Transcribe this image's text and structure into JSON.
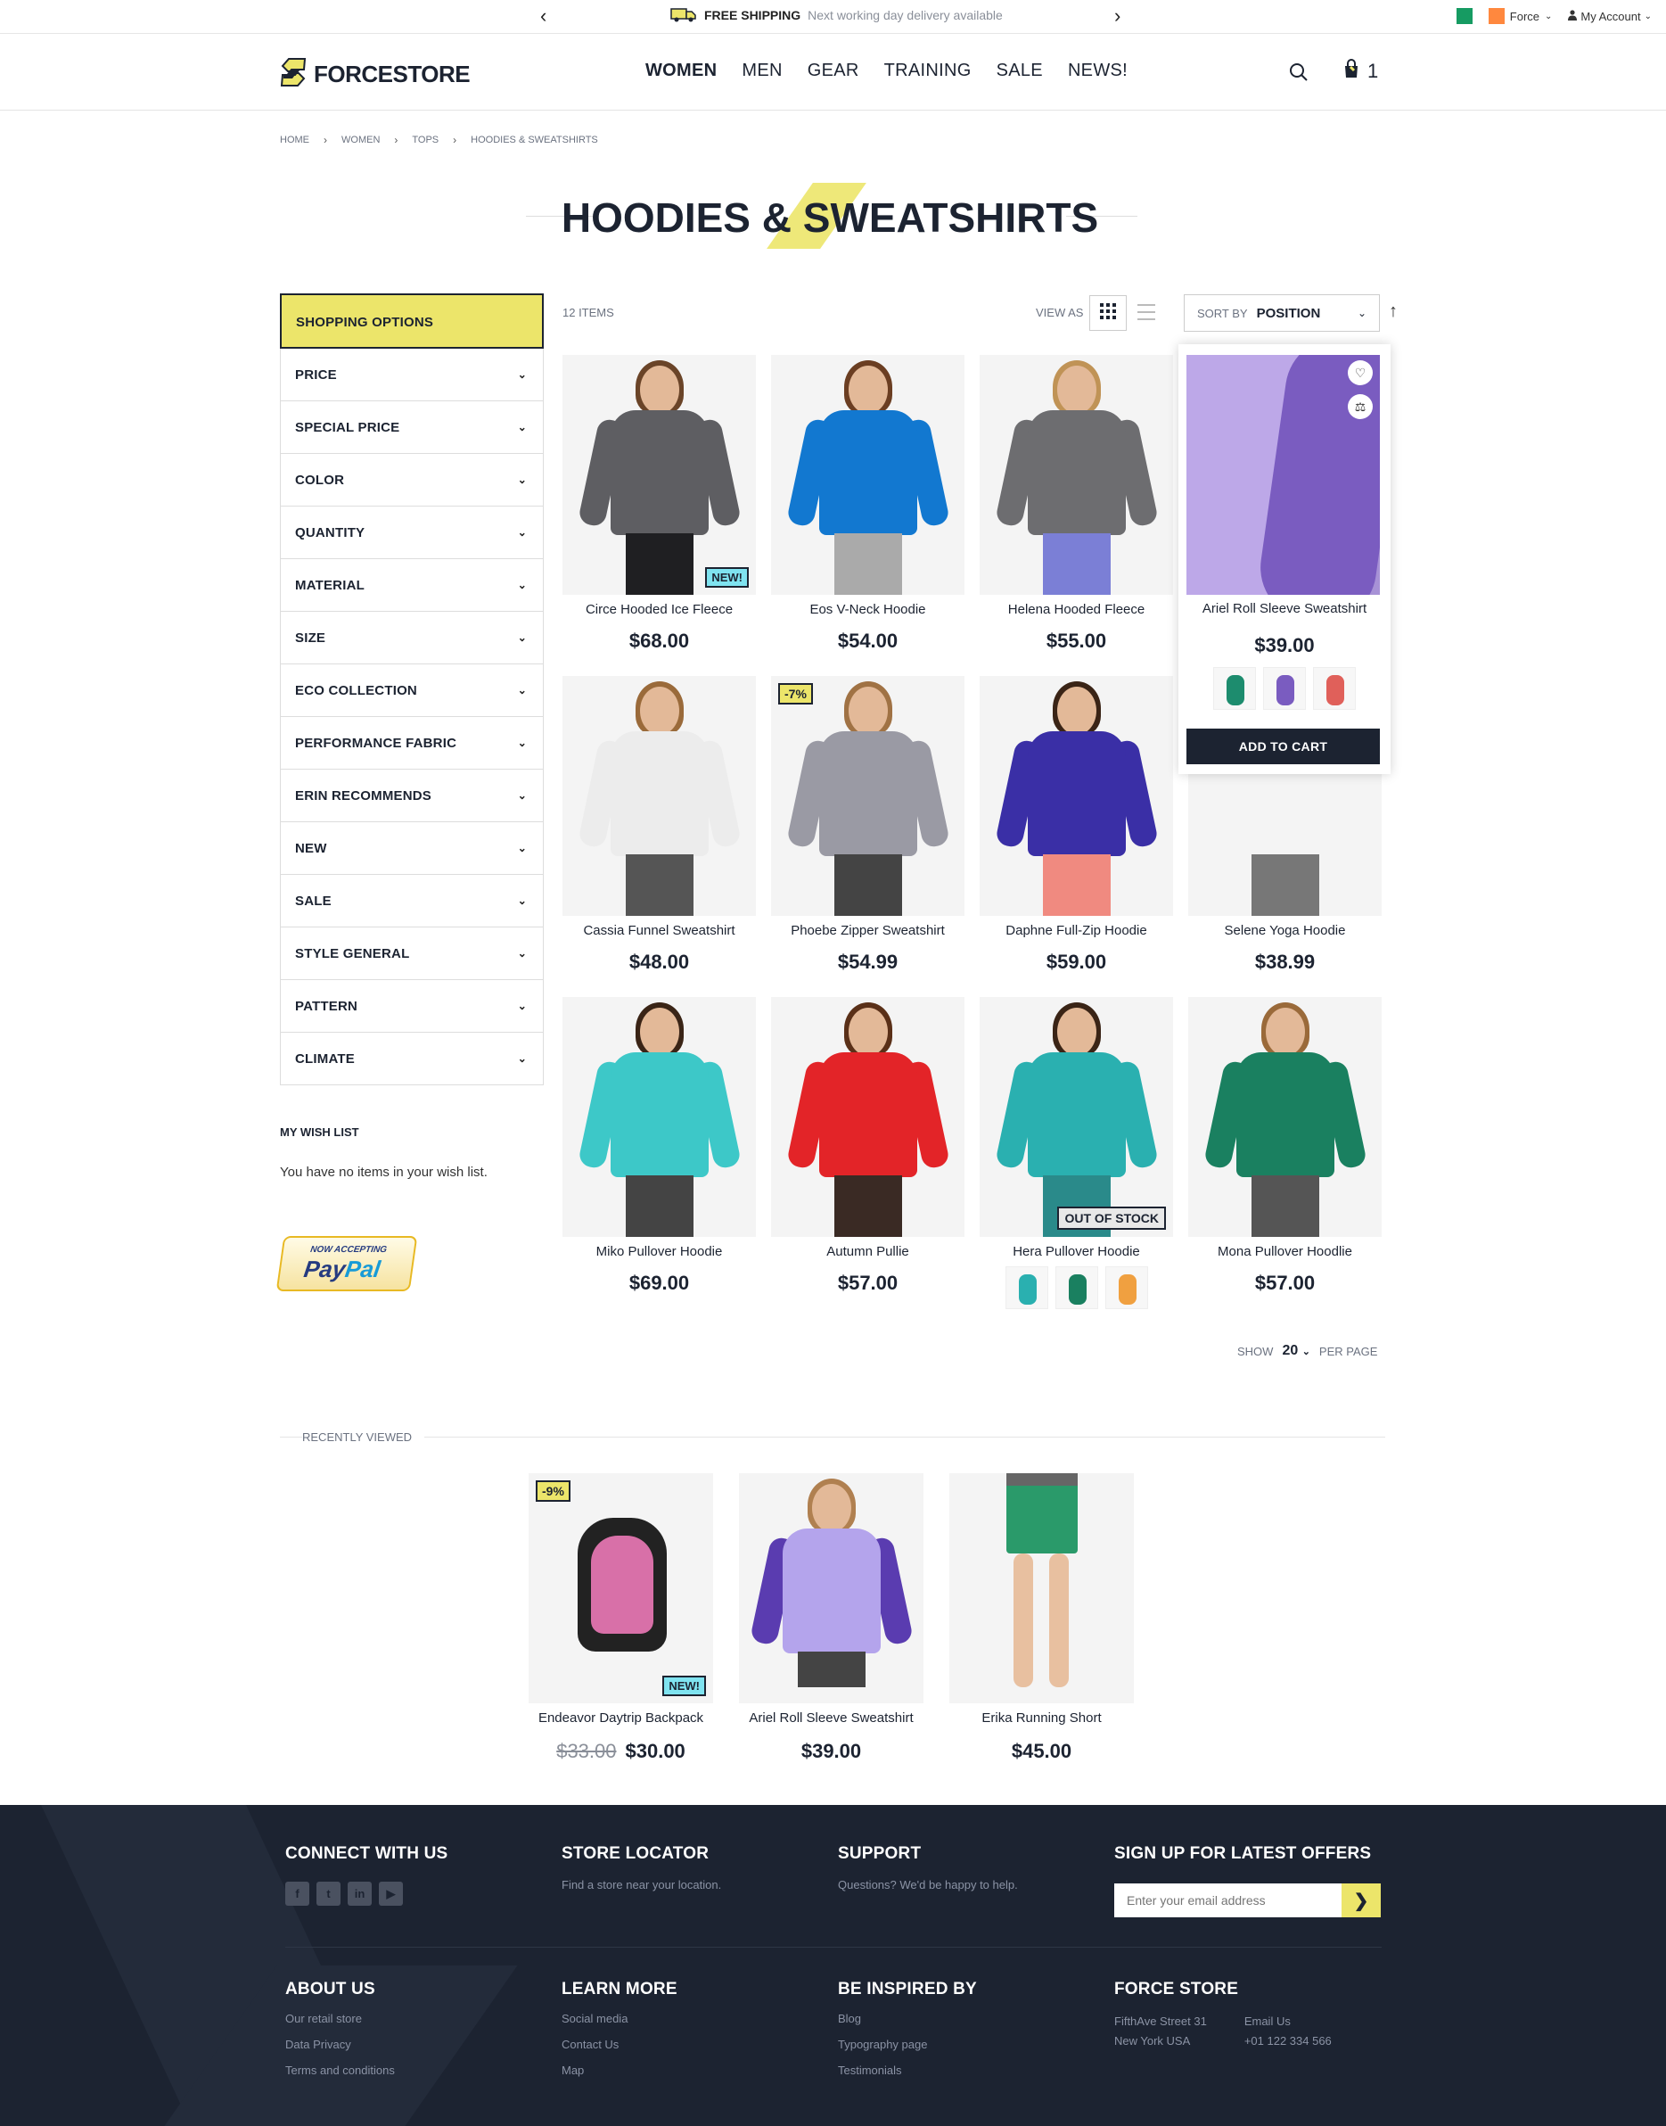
{
  "topbar": {
    "shipping_bold": "FREE SHIPPING",
    "shipping_sub": "Next working day delivery available",
    "store_switcher": "Force",
    "account": "My Account"
  },
  "header": {
    "logo": "FORCESTORE",
    "nav": [
      "WOMEN",
      "MEN",
      "GEAR",
      "TRAINING",
      "SALE",
      "NEWS!"
    ],
    "cart_count": "1"
  },
  "breadcrumb": [
    "HOME",
    "WOMEN",
    "TOPS",
    "HOODIES & SWEATSHIRTS"
  ],
  "page_title": "HOODIES & SWEATSHIRTS",
  "sidebar": {
    "heading": "SHOPPING OPTIONS",
    "filters": [
      "PRICE",
      "SPECIAL PRICE",
      "COLOR",
      "QUANTITY",
      "MATERIAL",
      "SIZE",
      "ECO COLLECTION",
      "PERFORMANCE FABRIC",
      "ERIN RECOMMENDS",
      "NEW",
      "SALE",
      "STYLE GENERAL",
      "PATTERN",
      "CLIMATE"
    ],
    "wishlist_title": "MY WISH LIST",
    "wishlist_text": "You have no items in your wish list.",
    "paypal_line1": "NOW ACCEPTING",
    "paypal_line2a": "Pay",
    "paypal_line2b": "Pal"
  },
  "toolbar": {
    "items": "12 ITEMS",
    "view_as": "VIEW AS",
    "sort_label": "SORT BY",
    "sort_value": "POSITION"
  },
  "products": [
    {
      "name": "Circe Hooded Ice Fleece",
      "price": "$68.00",
      "badge": "NEW!"
    },
    {
      "name": "Eos V-Neck Hoodie",
      "price": "$54.00"
    },
    {
      "name": "Helena Hooded Fleece",
      "price": "$55.00"
    },
    {
      "name": "Ariel Roll Sleeve Sweatshirt",
      "price": "$39.00"
    },
    {
      "name": "Cassia Funnel Sweatshirt",
      "price": "$48.00"
    },
    {
      "name": "Phoebe Zipper Sweatshirt",
      "price": "$54.99",
      "badge": "-7%"
    },
    {
      "name": "Daphne Full-Zip Hoodie",
      "price": "$59.00"
    },
    {
      "name": "Selene Yoga Hoodie",
      "price": "$38.99"
    },
    {
      "name": "Miko Pullover Hoodie",
      "price": "$69.00"
    },
    {
      "name": "Autumn Pullie",
      "price": "$57.00"
    },
    {
      "name": "Hera Pullover Hoodie",
      "price": "",
      "badge": "OUT OF STOCK"
    },
    {
      "name": "Mona Pullover Hoodlie",
      "price": "$57.00"
    }
  ],
  "hover_card": {
    "add_to_cart": "ADD TO CART"
  },
  "pager": {
    "show": "SHOW",
    "value": "20",
    "per_page": "PER PAGE"
  },
  "recently_viewed": {
    "label": "RECENTLY VIEWED",
    "items": [
      {
        "name": "Endeavor Daytrip Backpack",
        "old_price": "$33.00",
        "price": "$30.00",
        "badge_pct": "-9%",
        "badge_new": "NEW!"
      },
      {
        "name": "Ariel Roll Sleeve Sweatshirt",
        "price": "$39.00"
      },
      {
        "name": "Erika Running Short",
        "price": "$45.00"
      }
    ]
  },
  "footer": {
    "connect": "CONNECT WITH US",
    "social": [
      "f",
      "t",
      "in",
      "▶"
    ],
    "locator": "STORE LOCATOR",
    "locator_text": "Find a store near your location.",
    "support": "SUPPORT",
    "support_text": "Questions? We'd be happy to help.",
    "signup": "SIGN UP FOR LATEST OFFERS",
    "email_placeholder": "Enter your email address",
    "about": "ABOUT US",
    "about_links": [
      "Our retail store",
      "Data Privacy",
      "Terms and conditions"
    ],
    "learn": "LEARN MORE",
    "learn_links": [
      "Social media",
      "Contact Us",
      "Map"
    ],
    "inspired": "BE INSPIRED BY",
    "inspired_links": [
      "Blog",
      "Typography page",
      "Testimonials"
    ],
    "store": "FORCE STORE",
    "address1": "FifthAve Street 31",
    "address2": "New York USA",
    "email_label": "Email Us",
    "phone": "+01 122 334 566"
  },
  "colors": {
    "accent": "#ece56a",
    "dark": "#1c2331",
    "badge_new": "#7fe3f0"
  },
  "icons": [
    "chevron-left-icon",
    "chevron-right-icon",
    "truck-icon",
    "user-icon",
    "search-icon",
    "cart-icon",
    "grid-icon",
    "list-icon",
    "sort-direction-icon",
    "heart-icon",
    "compare-icon",
    "facebook-icon",
    "twitter-icon",
    "linkedin-icon",
    "youtube-icon",
    "arrow-right-icon"
  ]
}
